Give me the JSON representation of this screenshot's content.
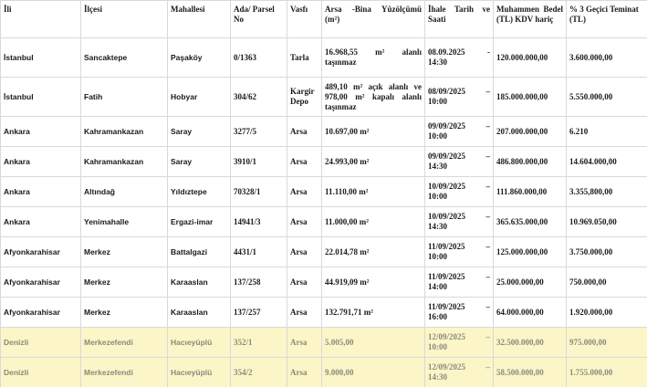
{
  "headers": {
    "il": "İli",
    "ilce": "İlçesi",
    "mahalle": "Mahallesi",
    "ada": "Ada/ Parsel No",
    "vasfi": "Vasfı",
    "arsa": "Arsa -Bina Yüzölçümü (m²)",
    "ihale": "İhale Tarih ve Saati",
    "bedel": "Muhammen Bedel (TL) KDV hariç",
    "teminat": "% 3 Geçici Teminat (TL)"
  },
  "rows": [
    {
      "il": "İstanbul",
      "ilce": "Sancaktepe",
      "mahalle": "Paşaköy",
      "ada": "0/1363",
      "vasfi": "Tarla",
      "arsa": "16.968,55 m² alanlı taşınmaz",
      "ihale": "08.09.2025 - 14:30",
      "bedel": "120.000.000,00",
      "teminat": "3.600.000,00"
    },
    {
      "il": "İstanbul",
      "ilce": "Fatih",
      "mahalle": "Hobyar",
      "ada": "304/62",
      "vasfi": "Kargir Depo",
      "arsa": "489,10 m² açık alanlı ve 978,00 m² kapalı alanlı taşınmaz",
      "ihale": "08/09/2025 – 10:00",
      "bedel": "185.000.000,00",
      "teminat": "5.550.000,00"
    },
    {
      "il": "Ankara",
      "ilce": "Kahramankazan",
      "mahalle": "Saray",
      "ada": "3277/5",
      "vasfi": "Arsa",
      "arsa": "10.697,00 m²",
      "ihale": "09/09/2025 – 10:00",
      "bedel": "207.000.000,00",
      "teminat": "6.210"
    },
    {
      "il": "Ankara",
      "ilce": "Kahramankazan",
      "mahalle": "Saray",
      "ada": "3910/1",
      "vasfi": "Arsa",
      "arsa": "24.993,00 m²",
      "ihale": "09/09/2025 – 14:30",
      "bedel": "486.800.000,00",
      "teminat": "14.604.000,00"
    },
    {
      "il": "Ankara",
      "ilce": "Altındağ",
      "mahalle": "Yıldıztepe",
      "ada": "70328/1",
      "vasfi": "Arsa",
      "arsa": "11.110,00 m²",
      "ihale": "10/09/2025 – 10:00",
      "bedel": "111.860.000,00",
      "teminat": "3.355,800,00"
    },
    {
      "il": "Ankara",
      "ilce": "Yenimahalle",
      "mahalle": "Ergazi-imar",
      "ada": "14941/3",
      "vasfi": "Arsa",
      "arsa": "11.000,00 m²",
      "ihale": "10/09/2025 – 14:30",
      "bedel": "365.635.000,00",
      "teminat": "10.969.050,00"
    },
    {
      "il": "Afyonkarahisar",
      "ilce": "Merkez",
      "mahalle": "Battalgazi",
      "ada": "4431/1",
      "vasfi": "Arsa",
      "arsa": "22.014,78 m²",
      "ihale": "11/09/2025 – 10:00",
      "bedel": "125.000.000,00",
      "teminat": "3.750.000,00"
    },
    {
      "il": "Afyonkarahisar",
      "ilce": "Merkez",
      "mahalle": "Karaaslan",
      "ada": "137/258",
      "vasfi": "Arsa",
      "arsa": "44.919,09 m²",
      "ihale": "11/09/2025 – 14:00",
      "bedel": "25.000.000,00",
      "teminat": "750.000,00"
    },
    {
      "il": "Afyonkarahisar",
      "ilce": "Merkez",
      "mahalle": "Karaaslan",
      "ada": "137/257",
      "vasfi": "Arsa",
      "arsa": "132.791,71 m²",
      "ihale": "11/09/2025 – 16:00",
      "bedel": "64.000.000,00",
      "teminat": "1.920.000,00"
    },
    {
      "il": "Denizli",
      "ilce": "Merkezefendi",
      "mahalle": "Hacıeyüplü",
      "ada": "352/1",
      "vasfi": "Arsa",
      "arsa": "5.005,00",
      "ihale": "12/09/2025 – 10:00",
      "bedel": "32.500.000,00",
      "teminat": "975.000,00"
    },
    {
      "il": "Denizli",
      "ilce": "Merkezefendi",
      "mahalle": "Hacıeyüplü",
      "ada": "354/2",
      "vasfi": "Arsa",
      "arsa": "9.000,00",
      "ihale": "12/09/2025 – 14:30",
      "bedel": "58.500.000,00",
      "teminat": "1.755.000,00"
    }
  ],
  "colors": {
    "highlight_row_bg": "#fbf5c8",
    "border": "#d9d9d9"
  }
}
